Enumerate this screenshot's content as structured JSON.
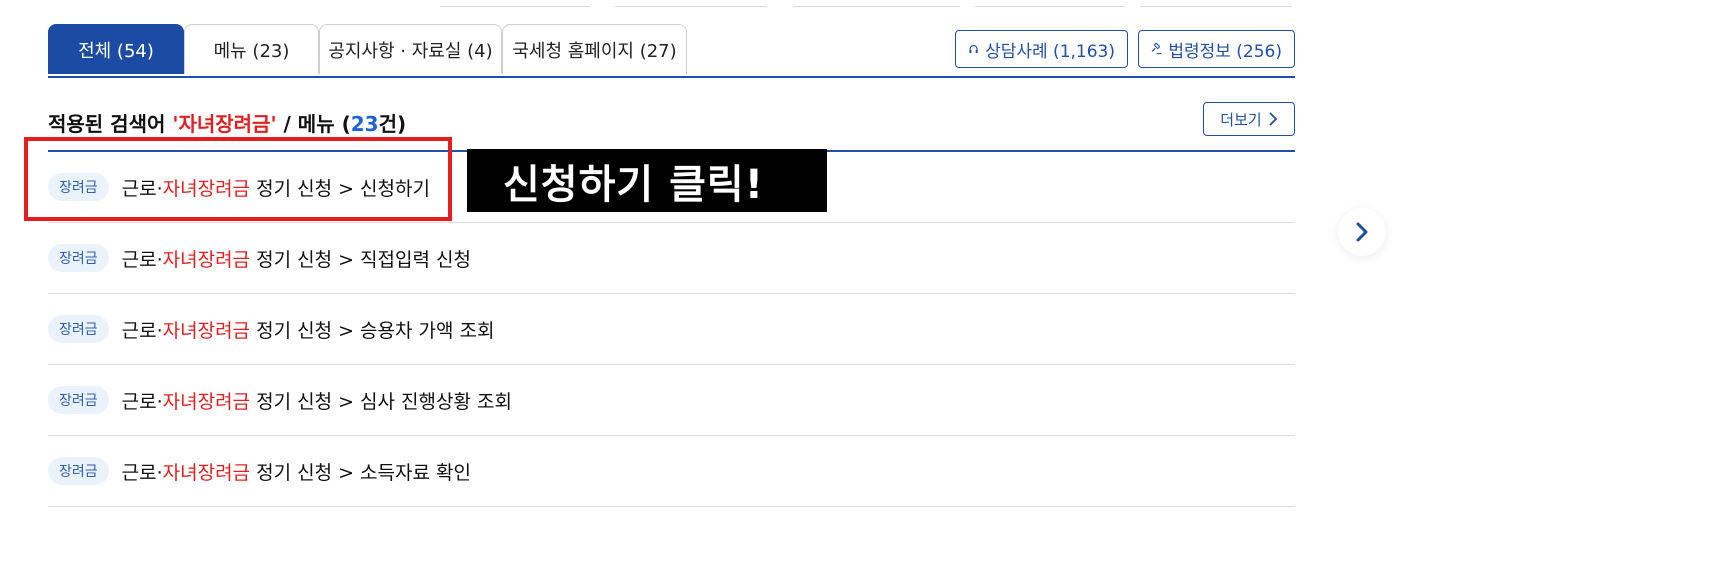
{
  "tabs": [
    {
      "label": "전체 (54)",
      "active": true
    },
    {
      "label": "메뉴 (23)",
      "active": false
    },
    {
      "label": "공지사항 · 자료실 (4)",
      "active": false
    },
    {
      "label": "국세청 홈페이지 (27)",
      "active": false
    }
  ],
  "external_buttons": {
    "consult": {
      "label": "상담사례 (1,163)",
      "icon": "headset-icon"
    },
    "law": {
      "label": "법령정보 (256)",
      "icon": "gavel-icon"
    }
  },
  "heading": {
    "prefix": "적용된 검색어 ",
    "keyword": "'자녀장려금'",
    "middle": " / 메뉴 (",
    "count": "23",
    "suffix": "건)"
  },
  "more_button": {
    "label": "더보기"
  },
  "results": [
    {
      "badge": "장려금",
      "pre": "근로·",
      "keyword": "자녀장려금",
      "post": " 정기 신청 > 신청하기"
    },
    {
      "badge": "장려금",
      "pre": "근로·",
      "keyword": "자녀장려금",
      "post": " 정기 신청 > 직접입력 신청"
    },
    {
      "badge": "장려금",
      "pre": "근로·",
      "keyword": "자녀장려금",
      "post": " 정기 신청 > 승용차 가액 조회"
    },
    {
      "badge": "장려금",
      "pre": "근로·",
      "keyword": "자녀장려금",
      "post": " 정기 신청 > 심사 진행상황 조회"
    },
    {
      "badge": "장려금",
      "pre": "근로·",
      "keyword": "자녀장려금",
      "post": " 정기 신청 > 소득자료 확인"
    }
  ],
  "annotation": {
    "callout_text": "신청하기 클릭!"
  },
  "colors": {
    "primary": "#1c4ba3",
    "keyword": "#e02020",
    "count": "#1f64d6",
    "badge_bg": "#eaf2fb",
    "annotation_box": "#e41e1e"
  }
}
